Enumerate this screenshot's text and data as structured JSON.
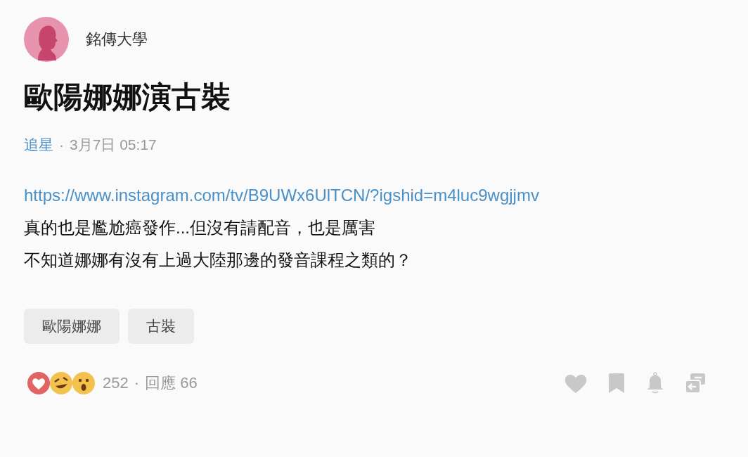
{
  "author": {
    "name": "銘傳大學"
  },
  "title": "歐陽娜娜演古裝",
  "meta": {
    "board": "追星",
    "separator": "·",
    "date": "3月7日 05:17"
  },
  "body": [
    {
      "kind": "link",
      "text": "https://www.instagram.com/tv/B9UWx6UlTCN/?igshid=m4luc9wgjjmv"
    },
    {
      "kind": "text",
      "text": "真的也是尷尬癌發作...但沒有請配音，也是厲害"
    },
    {
      "kind": "text",
      "text": "不知道娜娜有沒有上過大陸那邊的發音課程之類的？"
    }
  ],
  "tags": [
    "歐陽娜娜",
    "古裝"
  ],
  "footer": {
    "reaction_count": "252",
    "separator": "·",
    "replies": "回應 66"
  }
}
